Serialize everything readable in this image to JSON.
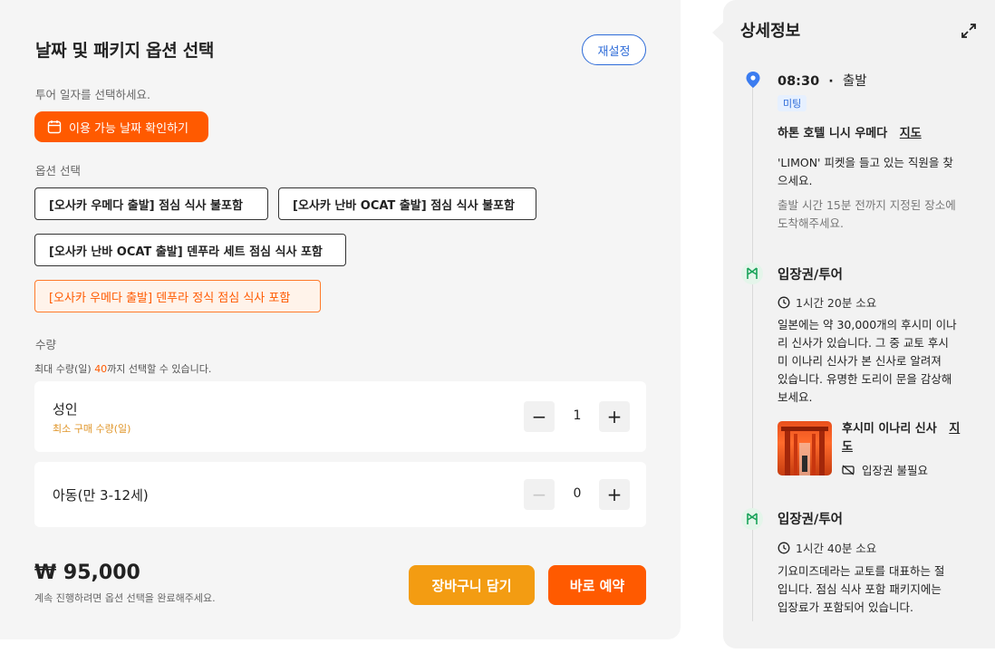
{
  "left": {
    "title": "날짜 및 패키지 옵션 선택",
    "reset_label": "재설정",
    "date_prompt": "투어 일자를 선택하세요.",
    "date_button_label": "이용 가능 날짜 확인하기",
    "options_label": "옵션 선택",
    "options": [
      "[오사카 우메다 출발] 점심 식사 불포함",
      "[오사카 난바 OCAT 출발] 점심 식사 불포함",
      "[오사카 난바 OCAT 출발] 덴푸라 세트 점심 식사 포함",
      "[오사카 우메다 출발] 덴푸라 정식 점심 식사 포함"
    ],
    "selected_option_index": 3,
    "quantity_label": "수량",
    "quantity_note_prefix": "최대 수량(일) ",
    "quantity_note_max": "40",
    "quantity_note_suffix": "까지 선택할 수 있습니다.",
    "adult": {
      "name": "성인",
      "min_note": "최소 구매 수량(일)",
      "value": "1",
      "minus": "−",
      "plus": "+"
    },
    "child": {
      "name": "아동(만 3-12세)",
      "value": "0",
      "minus": "−",
      "plus": "+"
    },
    "price": "₩ 95,000",
    "price_note": "계속 진행하려면 옵션 선택을 완료해주세요.",
    "cart_label": "장바구니 담기",
    "book_label": "바로 예약"
  },
  "right": {
    "title": "상세정보",
    "stop1": {
      "time": "08:30",
      "dot": "·",
      "action": "출발",
      "badge": "미팅",
      "place": "하톤 호텔 니시 우메다",
      "map_label": "지도",
      "desc_line1": "'LIMON' 피켓을 들고 있는 직원을 찾",
      "desc_line2": "으세요.",
      "note_line1": "출발 시간 15분 전까지 지정된 장소에",
      "note_line2": "도착해주세요."
    },
    "stop2": {
      "heading": "입장권/투어",
      "duration": "1시간 20분 소요",
      "desc_lines": [
        "일본에는 약 30,000개의 후시미 이나",
        "리 신사가 있습니다. 그 중 교토 후시",
        "미 이나리 신사가 본 신사로 알려져",
        "있습니다. 유명한 도리이 문을 감상해",
        "보세요."
      ],
      "poi_name": "후시미 이나리 신사",
      "poi_map_label_1": "지",
      "poi_map_label_2": "도",
      "poi_ticket": "입장권 불필요"
    },
    "stop3": {
      "heading": "입장권/투어",
      "duration": "1시간 40분 소요",
      "desc_lines": [
        "기요미즈데라는 교토를 대표하는 절",
        "입니다. 점심 식사 포함 패키지에는",
        "입장료가 포함되어 있습니다."
      ]
    }
  },
  "colors": {
    "accent": "#ff5a00",
    "cart": "#f39c12",
    "link_blue": "#2d6bd8",
    "ticket_green": "#1aa35a"
  }
}
